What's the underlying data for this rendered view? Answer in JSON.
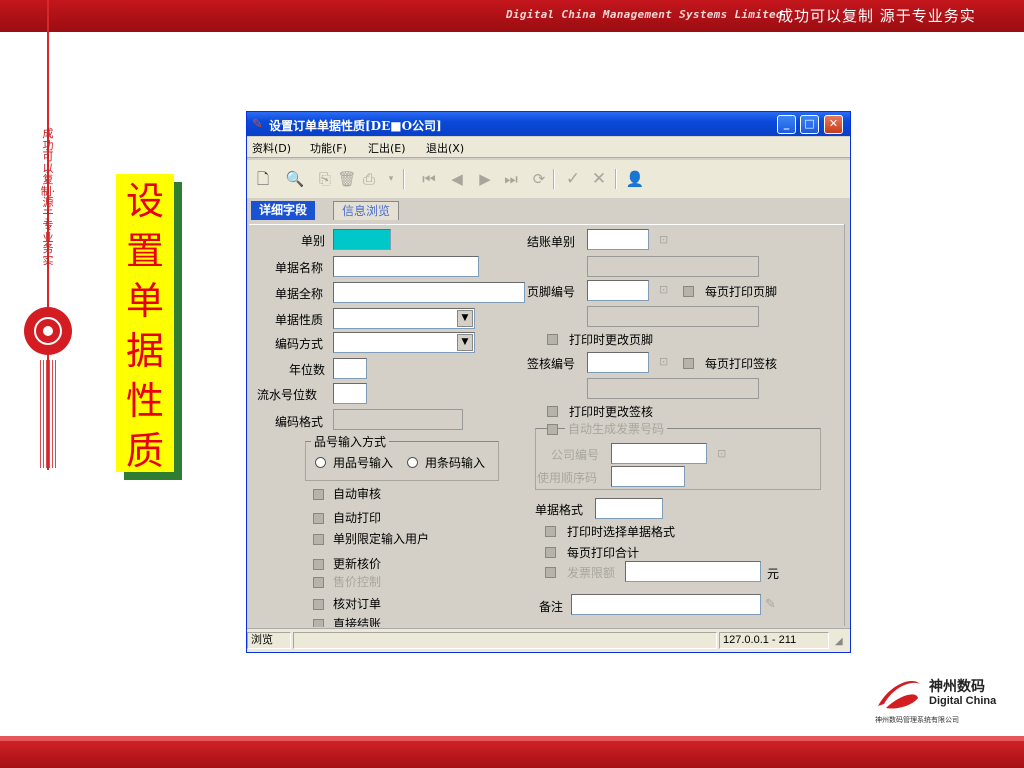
{
  "slide": {
    "header_subtitle": "Digital China Management Systems Limited",
    "header_slogan": "成功可以复制  源于专业务实",
    "vertical_text": "成功可以复制·源于专业务实",
    "title_chars": [
      "设",
      "置",
      "单",
      "据",
      "性",
      "质"
    ],
    "logo_cn": "神州数码",
    "logo_en": "Digital China",
    "logo_company": "神州数码管理系统有限公司"
  },
  "window": {
    "title": "设置订单单据性质[DE■O公司]",
    "menu": [
      "资料(D)",
      "功能(F)",
      "汇出(E)",
      "退出(X)"
    ],
    "tabs": {
      "active": "详细字段",
      "inactive": "信息浏览"
    },
    "status": {
      "mode": "浏览",
      "address": "127.0.0.1 - 211"
    }
  },
  "form": {
    "left": {
      "doc_type": "单别",
      "doc_name": "单据名称",
      "doc_fullname": "单据全称",
      "doc_nature": "单据性质",
      "code_method": "编码方式",
      "year_digits": "年位数",
      "serial_digits": "流水号位数",
      "code_format": "编码格式",
      "item_input_group": "品号输入方式",
      "radio_item_no": "用品号输入",
      "radio_barcode": "用条码输入",
      "checks": [
        "自动审核",
        "自动打印",
        "单别限定输入用户",
        "更新核价",
        "售价控制",
        "核对订单",
        "直接结账"
      ]
    },
    "right": {
      "settle_type": "结账单别",
      "footer_no": "页脚编号",
      "footer_each_page": "每页打印页脚",
      "print_change_footer": "打印时更改页脚",
      "sign_no": "签核编号",
      "sign_each_page": "每页打印签核",
      "print_change_sign": "打印时更改签核",
      "auto_invoice_group": "自动生成发票号码",
      "company_no": "公司编号",
      "use_seq": "使用顺序码",
      "doc_format": "单据格式",
      "print_select_format": "打印时选择单据格式",
      "print_total_each_page": "每页打印合计",
      "invoice_limit": "发票限额",
      "yuan": "元",
      "remark": "备注"
    }
  }
}
